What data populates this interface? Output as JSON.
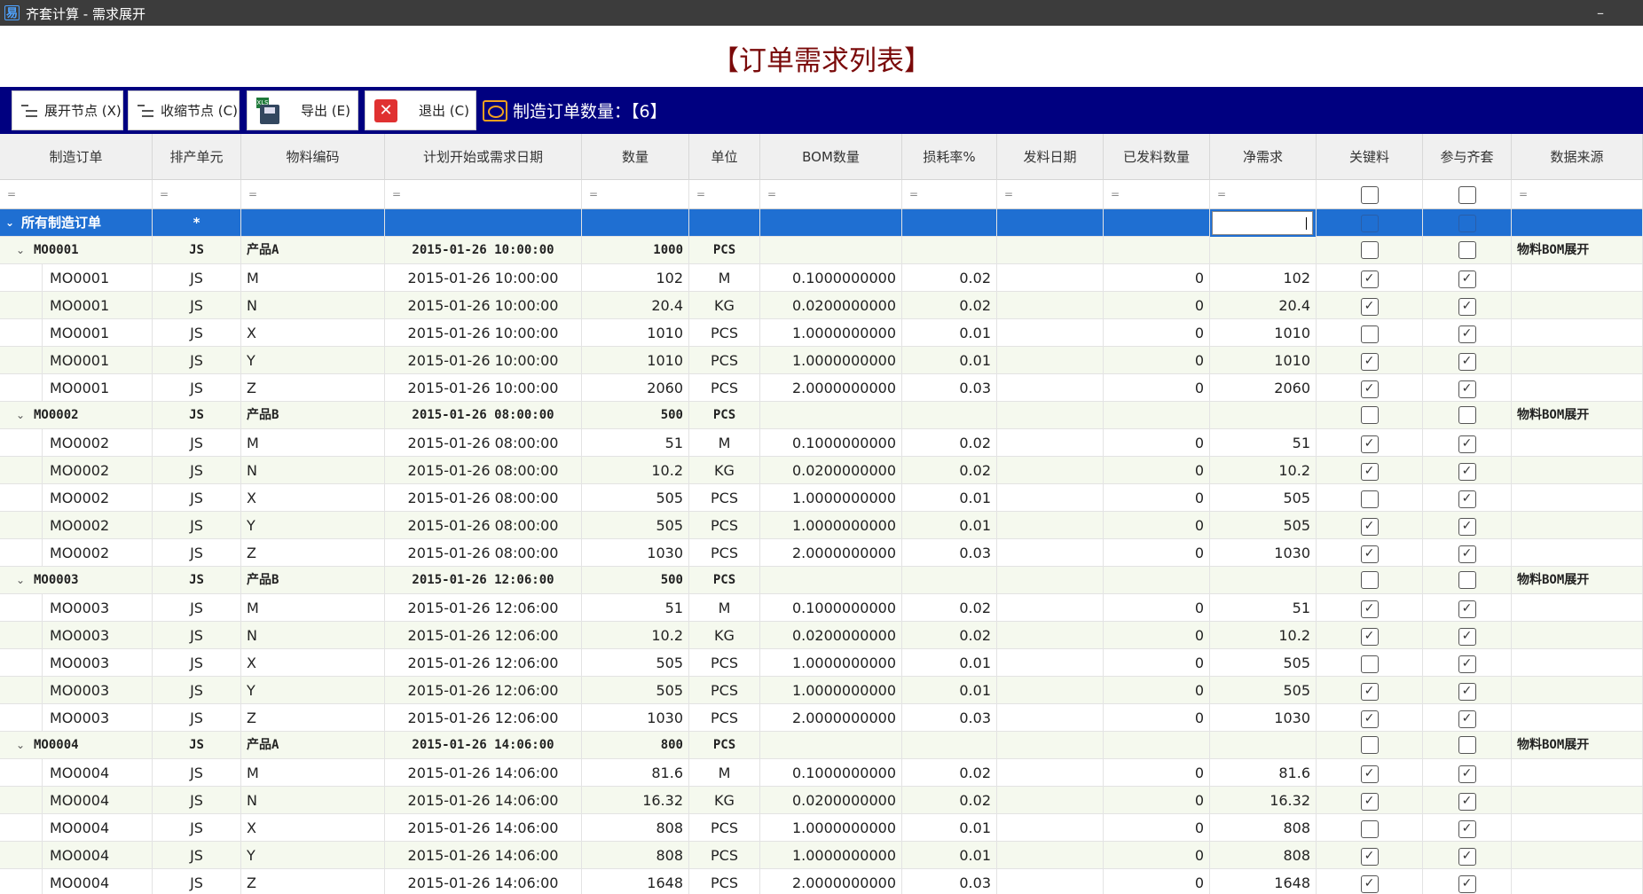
{
  "window": {
    "title": "齐套计算 - 需求展开",
    "app_icon": "app-logo-icon",
    "minimize": "–"
  },
  "page_title": "【订单需求列表】",
  "toolbar": {
    "expand_label": "展开节点 (X)",
    "collapse_label": "收缩节点 (C)",
    "export_label": "导出 (E)",
    "exit_label": "退出 (C)",
    "order_count_label": "制造订单数量：【6】"
  },
  "columns": [
    "制造订单",
    "排产单元",
    "物料编码",
    "计划开始或需求日期",
    "数量",
    "单位",
    "BOM数量",
    "损耗率%",
    "发料日期",
    "已发料数量",
    "净需求",
    "关键料",
    "参与齐套",
    "数据来源"
  ],
  "filter_glyph": "=",
  "root_row": {
    "label": "所有制造订单",
    "unit": "*"
  },
  "groups": [
    {
      "order": "MO0001",
      "unit": "JS",
      "material": "产品A",
      "date": "2015-01-26 10:00:00",
      "qty": "1000",
      "uom": "PCS",
      "source": "物料BOM展开",
      "items": [
        {
          "order": "MO0001",
          "unit": "JS",
          "material": "M",
          "date": "2015-01-26 10:00:00",
          "qty": "102",
          "uom": "M",
          "bom": "0.1000000000",
          "loss": "0.02",
          "issued": "0",
          "net": "102",
          "key": true,
          "kit": true
        },
        {
          "order": "MO0001",
          "unit": "JS",
          "material": "N",
          "date": "2015-01-26 10:00:00",
          "qty": "20.4",
          "uom": "KG",
          "bom": "0.0200000000",
          "loss": "0.02",
          "issued": "0",
          "net": "20.4",
          "key": true,
          "kit": true
        },
        {
          "order": "MO0001",
          "unit": "JS",
          "material": "X",
          "date": "2015-01-26 10:00:00",
          "qty": "1010",
          "uom": "PCS",
          "bom": "1.0000000000",
          "loss": "0.01",
          "issued": "0",
          "net": "1010",
          "key": false,
          "kit": true
        },
        {
          "order": "MO0001",
          "unit": "JS",
          "material": "Y",
          "date": "2015-01-26 10:00:00",
          "qty": "1010",
          "uom": "PCS",
          "bom": "1.0000000000",
          "loss": "0.01",
          "issued": "0",
          "net": "1010",
          "key": true,
          "kit": true
        },
        {
          "order": "MO0001",
          "unit": "JS",
          "material": "Z",
          "date": "2015-01-26 10:00:00",
          "qty": "2060",
          "uom": "PCS",
          "bom": "2.0000000000",
          "loss": "0.03",
          "issued": "0",
          "net": "2060",
          "key": true,
          "kit": true
        }
      ]
    },
    {
      "order": "MO0002",
      "unit": "JS",
      "material": "产品B",
      "date": "2015-01-26 08:00:00",
      "qty": "500",
      "uom": "PCS",
      "source": "物料BOM展开",
      "items": [
        {
          "order": "MO0002",
          "unit": "JS",
          "material": "M",
          "date": "2015-01-26 08:00:00",
          "qty": "51",
          "uom": "M",
          "bom": "0.1000000000",
          "loss": "0.02",
          "issued": "0",
          "net": "51",
          "key": true,
          "kit": true
        },
        {
          "order": "MO0002",
          "unit": "JS",
          "material": "N",
          "date": "2015-01-26 08:00:00",
          "qty": "10.2",
          "uom": "KG",
          "bom": "0.0200000000",
          "loss": "0.02",
          "issued": "0",
          "net": "10.2",
          "key": true,
          "kit": true
        },
        {
          "order": "MO0002",
          "unit": "JS",
          "material": "X",
          "date": "2015-01-26 08:00:00",
          "qty": "505",
          "uom": "PCS",
          "bom": "1.0000000000",
          "loss": "0.01",
          "issued": "0",
          "net": "505",
          "key": false,
          "kit": true
        },
        {
          "order": "MO0002",
          "unit": "JS",
          "material": "Y",
          "date": "2015-01-26 08:00:00",
          "qty": "505",
          "uom": "PCS",
          "bom": "1.0000000000",
          "loss": "0.01",
          "issued": "0",
          "net": "505",
          "key": true,
          "kit": true
        },
        {
          "order": "MO0002",
          "unit": "JS",
          "material": "Z",
          "date": "2015-01-26 08:00:00",
          "qty": "1030",
          "uom": "PCS",
          "bom": "2.0000000000",
          "loss": "0.03",
          "issued": "0",
          "net": "1030",
          "key": true,
          "kit": true
        }
      ]
    },
    {
      "order": "MO0003",
      "unit": "JS",
      "material": "产品B",
      "date": "2015-01-26 12:06:00",
      "qty": "500",
      "uom": "PCS",
      "source": "物料BOM展开",
      "items": [
        {
          "order": "MO0003",
          "unit": "JS",
          "material": "M",
          "date": "2015-01-26 12:06:00",
          "qty": "51",
          "uom": "M",
          "bom": "0.1000000000",
          "loss": "0.02",
          "issued": "0",
          "net": "51",
          "key": true,
          "kit": true
        },
        {
          "order": "MO0003",
          "unit": "JS",
          "material": "N",
          "date": "2015-01-26 12:06:00",
          "qty": "10.2",
          "uom": "KG",
          "bom": "0.0200000000",
          "loss": "0.02",
          "issued": "0",
          "net": "10.2",
          "key": true,
          "kit": true
        },
        {
          "order": "MO0003",
          "unit": "JS",
          "material": "X",
          "date": "2015-01-26 12:06:00",
          "qty": "505",
          "uom": "PCS",
          "bom": "1.0000000000",
          "loss": "0.01",
          "issued": "0",
          "net": "505",
          "key": false,
          "kit": true
        },
        {
          "order": "MO0003",
          "unit": "JS",
          "material": "Y",
          "date": "2015-01-26 12:06:00",
          "qty": "505",
          "uom": "PCS",
          "bom": "1.0000000000",
          "loss": "0.01",
          "issued": "0",
          "net": "505",
          "key": true,
          "kit": true
        },
        {
          "order": "MO0003",
          "unit": "JS",
          "material": "Z",
          "date": "2015-01-26 12:06:00",
          "qty": "1030",
          "uom": "PCS",
          "bom": "2.0000000000",
          "loss": "0.03",
          "issued": "0",
          "net": "1030",
          "key": true,
          "kit": true
        }
      ]
    },
    {
      "order": "MO0004",
      "unit": "JS",
      "material": "产品A",
      "date": "2015-01-26 14:06:00",
      "qty": "800",
      "uom": "PCS",
      "source": "物料BOM展开",
      "items": [
        {
          "order": "MO0004",
          "unit": "JS",
          "material": "M",
          "date": "2015-01-26 14:06:00",
          "qty": "81.6",
          "uom": "M",
          "bom": "0.1000000000",
          "loss": "0.02",
          "issued": "0",
          "net": "81.6",
          "key": true,
          "kit": true
        },
        {
          "order": "MO0004",
          "unit": "JS",
          "material": "N",
          "date": "2015-01-26 14:06:00",
          "qty": "16.32",
          "uom": "KG",
          "bom": "0.0200000000",
          "loss": "0.02",
          "issued": "0",
          "net": "16.32",
          "key": true,
          "kit": true
        },
        {
          "order": "MO0004",
          "unit": "JS",
          "material": "X",
          "date": "2015-01-26 14:06:00",
          "qty": "808",
          "uom": "PCS",
          "bom": "1.0000000000",
          "loss": "0.01",
          "issued": "0",
          "net": "808",
          "key": false,
          "kit": true
        },
        {
          "order": "MO0004",
          "unit": "JS",
          "material": "Y",
          "date": "2015-01-26 14:06:00",
          "qty": "808",
          "uom": "PCS",
          "bom": "1.0000000000",
          "loss": "0.01",
          "issued": "0",
          "net": "808",
          "key": true,
          "kit": true
        },
        {
          "order": "MO0004",
          "unit": "JS",
          "material": "Z",
          "date": "2015-01-26 14:06:00",
          "qty": "1648",
          "uom": "PCS",
          "bom": "2.0000000000",
          "loss": "0.03",
          "issued": "0",
          "net": "1648",
          "key": true,
          "kit": true
        }
      ]
    }
  ],
  "colors": {
    "title_red": "#7a0a0a",
    "toolbar_navy": "#000080",
    "selection_blue": "#1f6fd2",
    "stripe": "#f5f9ee"
  }
}
